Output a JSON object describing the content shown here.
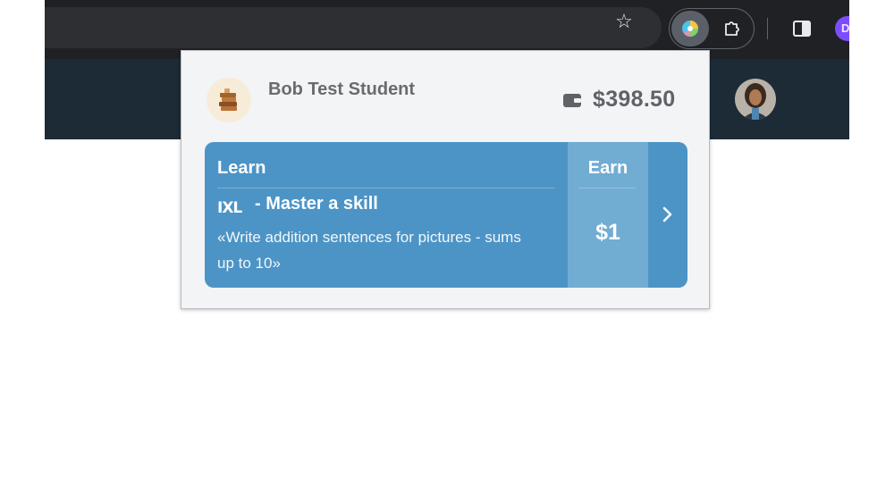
{
  "browser": {
    "profile_initial": "D"
  },
  "popup": {
    "student_name": "Bob Test Student",
    "balance": "$398.50",
    "card": {
      "section_label": "Learn",
      "provider_logo": "IXL",
      "task_title": "- Master a skill",
      "task_description": "«Write addition sentences for pictures - sums up to 10»",
      "earn_label": "Earn",
      "earn_amount": "$1"
    }
  },
  "icons": {
    "bookmark": "star-icon",
    "extension": "byte-extension-icon",
    "extensions_menu": "puzzle-icon",
    "side_panel": "side-panel-icon",
    "wallet": "wallet-icon",
    "avatar_stack": "books-stack-icon",
    "next": "chevron-right-icon"
  },
  "colors": {
    "card_blue": "#4c94c6",
    "earn_blue": "#71acd3",
    "header_dark": "#1c2b36"
  }
}
